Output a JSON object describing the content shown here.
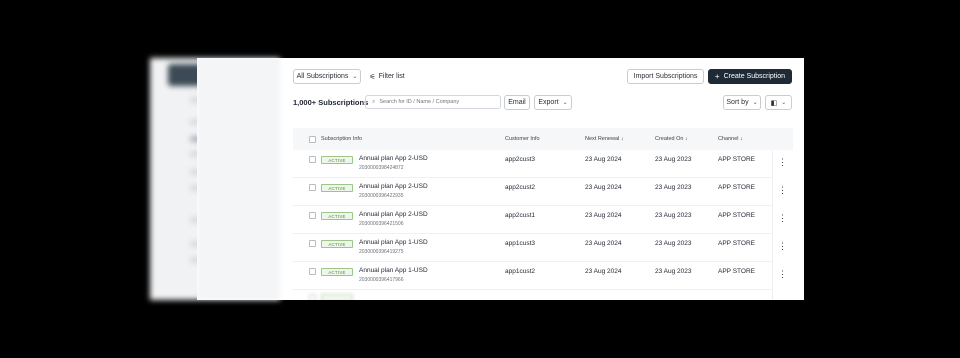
{
  "toolbar": {
    "subscriptions_filter": "All Subscriptions",
    "filter_list": "Filter list",
    "import_label": "Import Subscriptions",
    "create_label": "Create Subscription",
    "create_icon": "+"
  },
  "listbar": {
    "count": "1,000+ Subscriptions",
    "search_placeholder": "Search for ID / Name / Company",
    "email_label": "Email",
    "export_label": "Export",
    "sort_label": "Sort by"
  },
  "table": {
    "headers": {
      "subscription_info": "Subscription Info",
      "customer_info": "Customer Info",
      "next_renewal": "Next Renewal ↓",
      "created_on": "Created On ↓",
      "channel": "Channel ↓"
    },
    "rows": [
      {
        "status": "ACTIVE",
        "plan": "Annual plan App 2-USD",
        "id": "2030000398424872",
        "customer": "app2cust3",
        "renewal": "23 Aug 2024",
        "created": "23 Aug 2023",
        "channel": "APP STORE"
      },
      {
        "status": "ACTIVE",
        "plan": "Annual plan App 2-USD",
        "id": "2030000396422935",
        "customer": "app2cust2",
        "renewal": "23 Aug 2024",
        "created": "23 Aug 2023",
        "channel": "APP STORE"
      },
      {
        "status": "ACTIVE",
        "plan": "Annual plan App 2-USD",
        "id": "2030000396421506",
        "customer": "app2cust1",
        "renewal": "23 Aug 2024",
        "created": "23 Aug 2023",
        "channel": "APP STORE"
      },
      {
        "status": "ACTIVE",
        "plan": "Annual plan App 1-USD",
        "id": "2030000396419275",
        "customer": "app1cust3",
        "renewal": "23 Aug 2024",
        "created": "23 Aug 2023",
        "channel": "APP STORE"
      },
      {
        "status": "ACTIVE",
        "plan": "Annual plan App 1-USD",
        "id": "2030000396417966",
        "customer": "app1cust2",
        "renewal": "23 Aug 2024",
        "created": "23 Aug 2023",
        "channel": "APP STORE"
      }
    ]
  },
  "icons": {
    "filter": "filter-icon",
    "search": "search-icon",
    "columns": "columns-icon",
    "more": "more-vertical-icon"
  }
}
